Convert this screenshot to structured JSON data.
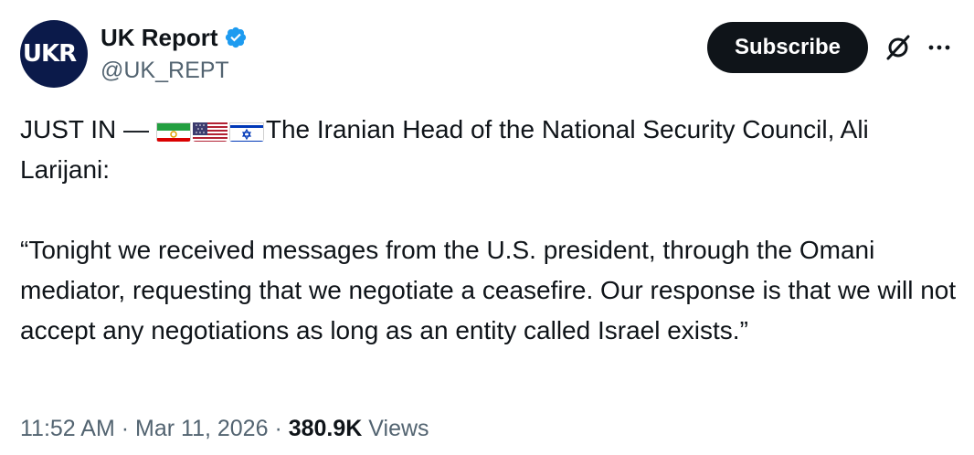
{
  "author": {
    "avatar_text": "UKR",
    "display_name": "UK Report",
    "handle": "@UK_REPT",
    "verified": true
  },
  "actions": {
    "subscribe_label": "Subscribe",
    "grok_icon": "grok-icon",
    "more_icon": "more-icon"
  },
  "tweet": {
    "prefix": "JUST IN —",
    "flags": [
      "iran-flag",
      "us-flag",
      "israel-flag"
    ],
    "headline": "The Iranian Head of the National Security Council, Ali Larijani:",
    "quote": "“Tonight we received messages from the U.S. president, through the Omani mediator, requesting that we negotiate a ceasefire. Our response is that we will not accept any negotiations as long as an entity called Israel exists.”"
  },
  "meta": {
    "time": "11:52 AM",
    "date": "Mar 11, 2026",
    "separator": "·",
    "views_count": "380.9K",
    "views_label": "Views"
  },
  "colors": {
    "text_primary": "#0f1419",
    "text_secondary": "#536471",
    "verified_blue": "#1d9bf0",
    "avatar_bg": "#0b1a4a",
    "button_bg": "#0f1419"
  }
}
